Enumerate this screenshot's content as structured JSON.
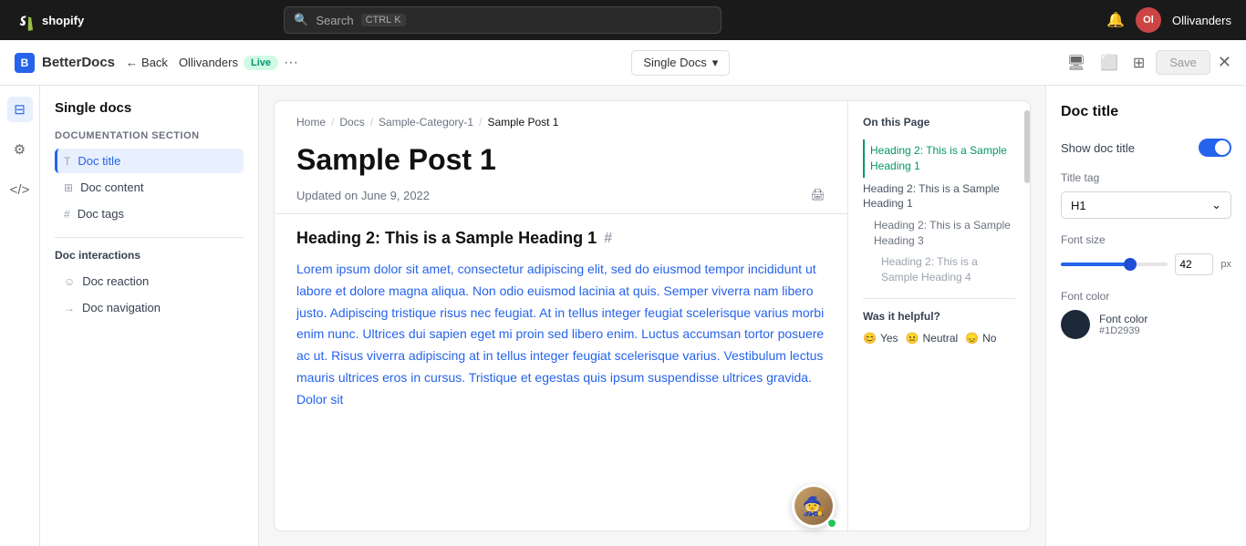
{
  "topbar": {
    "logo_text": "shopify",
    "search_placeholder": "Search",
    "shortcut_key1": "CTRL",
    "shortcut_key2": "K",
    "store_name": "Ollivanders"
  },
  "app_header": {
    "back_label": "Back",
    "store_name": "Ollivanders",
    "live_badge": "Live",
    "more": "···",
    "doc_type": "Single Docs",
    "save_label": "Save",
    "app_title": "BetterDocs"
  },
  "left_panel": {
    "title": "Single docs",
    "section_label": "Documentation section",
    "nav_items": [
      {
        "id": "doc-title",
        "label": "Doc title",
        "icon": "T",
        "active": true
      },
      {
        "id": "doc-content",
        "label": "Doc content",
        "icon": "⊞"
      },
      {
        "id": "doc-tags",
        "label": "Doc tags",
        "icon": "#"
      }
    ],
    "interactions_label": "Doc interactions",
    "interaction_items": [
      {
        "id": "doc-reaction",
        "label": "Doc reaction",
        "icon": "☺"
      },
      {
        "id": "doc-navigation",
        "label": "Doc navigation",
        "icon": "→"
      }
    ]
  },
  "breadcrumb": {
    "home": "Home",
    "docs": "Docs",
    "category": "Sample-Category-1",
    "current": "Sample Post 1"
  },
  "doc_preview": {
    "title": "Sample Post 1",
    "meta": "Updated on June 9, 2022",
    "heading": "Heading 2: This is a Sample Heading 1",
    "hash": "#",
    "body_text": "Lorem ipsum dolor sit amet, consectetur adipiscing elit, sed do eiusmod tempor incididunt ut labore et dolore magna aliqua. Non odio euismod lacinia at quis. Semper viverra nam libero justo. Adipiscing tristique risus nec feugiat. At in tellus integer feugiat scelerisque varius morbi enim nunc. Ultrices dui sapien eget mi proin sed libero enim. Luctus accumsan tortor posuere ac ut. Risus viverra adipiscing at in tellus integer feugiat scelerisque varius. Vestibulum lectus mauris ultrices eros in cursus. Tristique et egestas quis ipsum suspendisse ultrices gravida. Dolor sit"
  },
  "toc": {
    "title": "On this Page",
    "items": [
      {
        "label": "Heading 2: This is a Sample Heading 1",
        "level": 1,
        "active": true
      },
      {
        "label": "Heading 2: This is a Sample Heading 1",
        "level": 1,
        "active": false
      },
      {
        "label": "Heading 2: This is a Sample Heading 3",
        "level": 2,
        "active": false
      },
      {
        "label": "Heading 2: This is a Sample Heading 4",
        "level": 3,
        "active": false
      }
    ],
    "helpful_title": "Was it helpful?",
    "helpful_yes": "Yes",
    "helpful_neutral": "Neutral",
    "helpful_no": "No"
  },
  "right_panel": {
    "title": "Doc title",
    "show_label": "Show doc title",
    "toggle_on": true,
    "title_tag_label": "Title tag",
    "title_tag_value": "H1",
    "font_size_label": "Font size",
    "font_size_value": "42",
    "font_size_unit": "px",
    "font_color_label": "Font color",
    "font_color_hex": "#1D2939",
    "font_color_value": "#1D2939"
  }
}
